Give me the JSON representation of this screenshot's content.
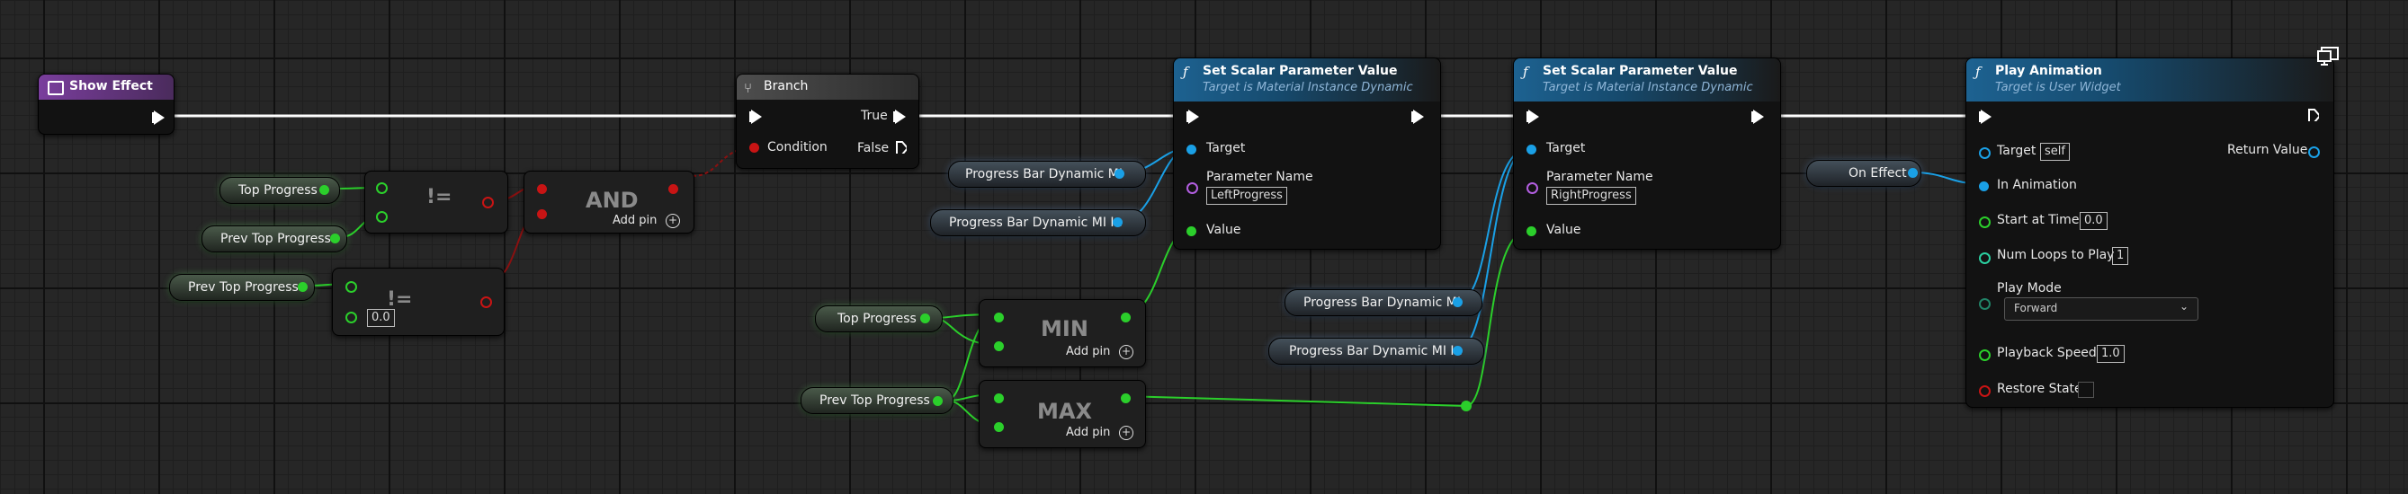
{
  "nodes": {
    "show_effect": {
      "title": "Show Effect"
    },
    "branch": {
      "title": "Branch",
      "condition": "Condition",
      "true_label": "True",
      "false_label": "False"
    },
    "and_node": {
      "title": "AND",
      "add_pin": "Add pin"
    },
    "not_equal_1": {
      "title": "!="
    },
    "not_equal_2": {
      "title": "!=",
      "value": "0.0"
    },
    "min_node": {
      "title": "MIN",
      "add_pin": "Add pin"
    },
    "max_node": {
      "title": "MAX",
      "add_pin": "Add pin"
    },
    "set_scalar_1": {
      "title": "Set Scalar Parameter Value",
      "subtitle": "Target is Material Instance Dynamic",
      "target": "Target",
      "param_name_label": "Parameter Name",
      "param_name_value": "LeftProgress",
      "value_label": "Value"
    },
    "set_scalar_2": {
      "title": "Set Scalar Parameter Value",
      "subtitle": "Target is Material Instance Dynamic",
      "target": "Target",
      "param_name_label": "Parameter Name",
      "param_name_value": "RightProgress",
      "value_label": "Value"
    },
    "play_animation": {
      "title": "Play Animation",
      "subtitle": "Target is User Widget",
      "target": "Target",
      "target_value": "self",
      "return_value": "Return Value",
      "in_animation": "In Animation",
      "start_at_time": "Start at Time",
      "start_at_time_value": "0.0",
      "num_loops": "Num Loops to Play",
      "num_loops_value": "1",
      "play_mode": "Play Mode",
      "play_mode_value": "Forward",
      "playback_speed": "Playback Speed",
      "playback_speed_value": "1.0",
      "restore_state": "Restore State"
    }
  },
  "variables": {
    "top_progress_1": "Top Progress",
    "prev_top_progress_1": "Prev Top Progress",
    "prev_top_progress_2": "Prev Top Progress",
    "pb_dyn_mi_1": "Progress Bar Dynamic MI",
    "pb_dyn_mi_in_1": "Progress Bar Dynamic MI In",
    "top_progress_2": "Top Progress",
    "prev_top_progress_3": "Prev Top Progress",
    "pb_dyn_mi_2": "Progress Bar Dynamic MI",
    "pb_dyn_mi_in_2": "Progress Bar Dynamic MI In",
    "on_effect": "On Effect"
  },
  "colors": {
    "exec": "#ffffff",
    "float": "#2bcf2b",
    "object": "#1aa0e6",
    "bool": "#c81414",
    "name": "#b25ee0",
    "graph_bg": "#262626"
  },
  "icons": {
    "branch": "branch-icon",
    "event": "event-icon",
    "function": "function-icon",
    "corner": "monitor-icon"
  }
}
